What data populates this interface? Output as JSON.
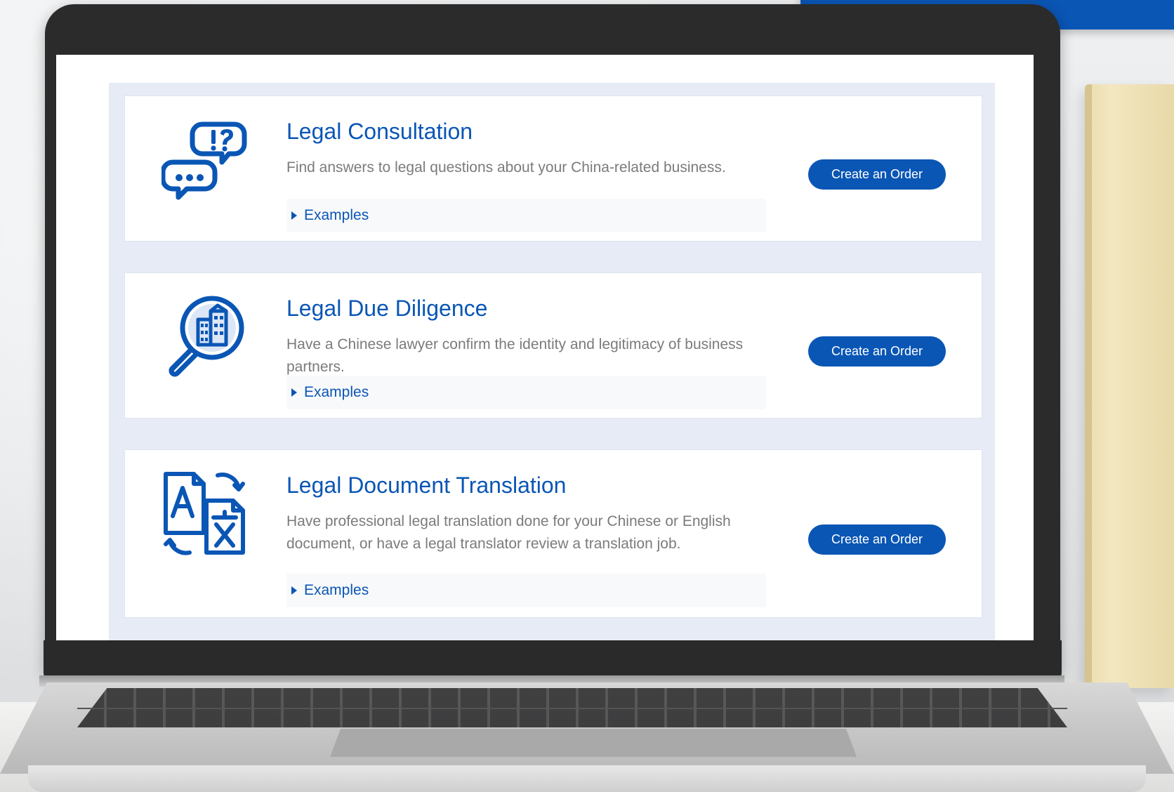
{
  "services": [
    {
      "title": "Legal Consultation",
      "description": "Find answers to legal questions about your China-related business.",
      "examples_label": "Examples",
      "button_label": "Create an Order",
      "icon": "speech-bubbles-icon"
    },
    {
      "title": "Legal Due Diligence",
      "description": "Have a Chinese lawyer confirm the identity and legitimacy of business partners.",
      "examples_label": "Examples",
      "button_label": "Create an Order",
      "icon": "magnifier-building-icon"
    },
    {
      "title": "Legal Document Translation",
      "description": "Have professional legal translation done for your Chinese or English document, or have a legal translator review a translation job.",
      "examples_label": "Examples",
      "button_label": "Create an Order",
      "icon": "document-translate-icon"
    }
  ],
  "colors": {
    "accent": "#0a56b5",
    "panel_bg": "#e6ebf5",
    "text_muted": "#7b7b7b"
  }
}
